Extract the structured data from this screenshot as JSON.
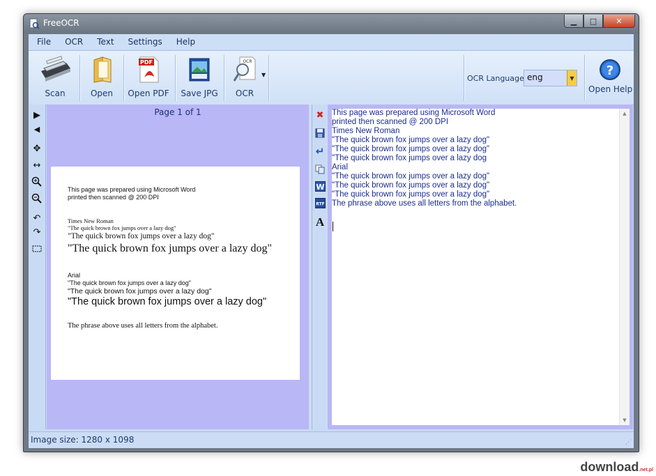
{
  "window": {
    "title": "FreeOCR"
  },
  "menu": [
    "File",
    "OCR",
    "Text",
    "Settings",
    "Help"
  ],
  "toolbar": {
    "scan": "Scan",
    "open": "Open",
    "open_pdf": "Open PDF",
    "save_jpg": "Save JPG",
    "ocr": "OCR",
    "ocr_language_label": "OCR Language:",
    "ocr_language_value": "eng",
    "open_help": "Open Help"
  },
  "image_view": {
    "page_label": "Page 1 of 1",
    "document_lines": [
      "This page was prepared using Microsoft Word",
      "printed then scanned @ 200 DPI",
      "Times New Roman",
      "\"The quick brown fox jumps over a lazy dog\"",
      "\"The quick brown fox jumps over a lazy dog\"",
      "\"The quick brown fox jumps over a lazy dog\"",
      "Arial",
      "\"The quick brown fox jumps over a lazy dog\"",
      "\"The quick brown fox  jumps over a lazy dog\"",
      "\"The quick brown fox jumps over a lazy dog\"",
      "The phrase above uses all letters from the alphabet."
    ]
  },
  "ocr_text": [
    "This page was prepared using Microsoft Word",
    "printed then scanned @ 200 DPI",
    "Times New Roman",
    "\"The quick brown fox jumps over a lazy dog\"",
    "\"The quick brown fox jumps over a lazy dog\"",
    "\"The quick brown fox jumps over a lazy dog",
    "Arial",
    "\"The quick brown fox jumps over a lazy dog\"",
    "\"The quick brown fox jumps over a lazy dog\"",
    "\"The quick brown fox jumps over a lazy dog\"",
    "The phrase above uses all letters from the alphabet."
  ],
  "status": {
    "image_size": "Image size:  1280 x  1098"
  },
  "watermark": {
    "brand": "download",
    "suffix": ".net.pl"
  },
  "icons": {
    "left_tools": [
      "next-page-icon",
      "previous-page-icon",
      "pan-icon",
      "fit-width-icon",
      "zoom-in-icon",
      "zoom-out-icon",
      "rotate-left-icon",
      "rotate-right-icon",
      "select-region-icon"
    ],
    "text_tools": [
      "clear-text-icon",
      "save-text-icon",
      "remove-line-breaks-icon",
      "copy-icon",
      "export-word-icon",
      "export-rtf-icon",
      "font-icon"
    ]
  },
  "colors": {
    "pane_background": "#b9b7f6",
    "ocr_text": "#1b2c8f",
    "toolbar": "#cfe0f6"
  }
}
